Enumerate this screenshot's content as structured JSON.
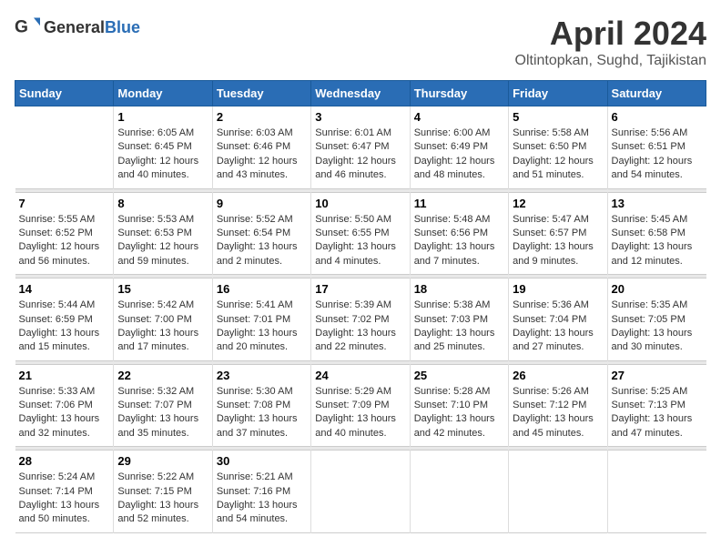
{
  "header": {
    "logo_general": "General",
    "logo_blue": "Blue",
    "title": "April 2024",
    "location": "Oltintopkan, Sughd, Tajikistan"
  },
  "weekdays": [
    "Sunday",
    "Monday",
    "Tuesday",
    "Wednesday",
    "Thursday",
    "Friday",
    "Saturday"
  ],
  "weeks": [
    [
      {
        "day": "",
        "sunrise": "",
        "sunset": "",
        "daylight": ""
      },
      {
        "day": "1",
        "sunrise": "Sunrise: 6:05 AM",
        "sunset": "Sunset: 6:45 PM",
        "daylight": "Daylight: 12 hours and 40 minutes."
      },
      {
        "day": "2",
        "sunrise": "Sunrise: 6:03 AM",
        "sunset": "Sunset: 6:46 PM",
        "daylight": "Daylight: 12 hours and 43 minutes."
      },
      {
        "day": "3",
        "sunrise": "Sunrise: 6:01 AM",
        "sunset": "Sunset: 6:47 PM",
        "daylight": "Daylight: 12 hours and 46 minutes."
      },
      {
        "day": "4",
        "sunrise": "Sunrise: 6:00 AM",
        "sunset": "Sunset: 6:49 PM",
        "daylight": "Daylight: 12 hours and 48 minutes."
      },
      {
        "day": "5",
        "sunrise": "Sunrise: 5:58 AM",
        "sunset": "Sunset: 6:50 PM",
        "daylight": "Daylight: 12 hours and 51 minutes."
      },
      {
        "day": "6",
        "sunrise": "Sunrise: 5:56 AM",
        "sunset": "Sunset: 6:51 PM",
        "daylight": "Daylight: 12 hours and 54 minutes."
      }
    ],
    [
      {
        "day": "7",
        "sunrise": "Sunrise: 5:55 AM",
        "sunset": "Sunset: 6:52 PM",
        "daylight": "Daylight: 12 hours and 56 minutes."
      },
      {
        "day": "8",
        "sunrise": "Sunrise: 5:53 AM",
        "sunset": "Sunset: 6:53 PM",
        "daylight": "Daylight: 12 hours and 59 minutes."
      },
      {
        "day": "9",
        "sunrise": "Sunrise: 5:52 AM",
        "sunset": "Sunset: 6:54 PM",
        "daylight": "Daylight: 13 hours and 2 minutes."
      },
      {
        "day": "10",
        "sunrise": "Sunrise: 5:50 AM",
        "sunset": "Sunset: 6:55 PM",
        "daylight": "Daylight: 13 hours and 4 minutes."
      },
      {
        "day": "11",
        "sunrise": "Sunrise: 5:48 AM",
        "sunset": "Sunset: 6:56 PM",
        "daylight": "Daylight: 13 hours and 7 minutes."
      },
      {
        "day": "12",
        "sunrise": "Sunrise: 5:47 AM",
        "sunset": "Sunset: 6:57 PM",
        "daylight": "Daylight: 13 hours and 9 minutes."
      },
      {
        "day": "13",
        "sunrise": "Sunrise: 5:45 AM",
        "sunset": "Sunset: 6:58 PM",
        "daylight": "Daylight: 13 hours and 12 minutes."
      }
    ],
    [
      {
        "day": "14",
        "sunrise": "Sunrise: 5:44 AM",
        "sunset": "Sunset: 6:59 PM",
        "daylight": "Daylight: 13 hours and 15 minutes."
      },
      {
        "day": "15",
        "sunrise": "Sunrise: 5:42 AM",
        "sunset": "Sunset: 7:00 PM",
        "daylight": "Daylight: 13 hours and 17 minutes."
      },
      {
        "day": "16",
        "sunrise": "Sunrise: 5:41 AM",
        "sunset": "Sunset: 7:01 PM",
        "daylight": "Daylight: 13 hours and 20 minutes."
      },
      {
        "day": "17",
        "sunrise": "Sunrise: 5:39 AM",
        "sunset": "Sunset: 7:02 PM",
        "daylight": "Daylight: 13 hours and 22 minutes."
      },
      {
        "day": "18",
        "sunrise": "Sunrise: 5:38 AM",
        "sunset": "Sunset: 7:03 PM",
        "daylight": "Daylight: 13 hours and 25 minutes."
      },
      {
        "day": "19",
        "sunrise": "Sunrise: 5:36 AM",
        "sunset": "Sunset: 7:04 PM",
        "daylight": "Daylight: 13 hours and 27 minutes."
      },
      {
        "day": "20",
        "sunrise": "Sunrise: 5:35 AM",
        "sunset": "Sunset: 7:05 PM",
        "daylight": "Daylight: 13 hours and 30 minutes."
      }
    ],
    [
      {
        "day": "21",
        "sunrise": "Sunrise: 5:33 AM",
        "sunset": "Sunset: 7:06 PM",
        "daylight": "Daylight: 13 hours and 32 minutes."
      },
      {
        "day": "22",
        "sunrise": "Sunrise: 5:32 AM",
        "sunset": "Sunset: 7:07 PM",
        "daylight": "Daylight: 13 hours and 35 minutes."
      },
      {
        "day": "23",
        "sunrise": "Sunrise: 5:30 AM",
        "sunset": "Sunset: 7:08 PM",
        "daylight": "Daylight: 13 hours and 37 minutes."
      },
      {
        "day": "24",
        "sunrise": "Sunrise: 5:29 AM",
        "sunset": "Sunset: 7:09 PM",
        "daylight": "Daylight: 13 hours and 40 minutes."
      },
      {
        "day": "25",
        "sunrise": "Sunrise: 5:28 AM",
        "sunset": "Sunset: 7:10 PM",
        "daylight": "Daylight: 13 hours and 42 minutes."
      },
      {
        "day": "26",
        "sunrise": "Sunrise: 5:26 AM",
        "sunset": "Sunset: 7:12 PM",
        "daylight": "Daylight: 13 hours and 45 minutes."
      },
      {
        "day": "27",
        "sunrise": "Sunrise: 5:25 AM",
        "sunset": "Sunset: 7:13 PM",
        "daylight": "Daylight: 13 hours and 47 minutes."
      }
    ],
    [
      {
        "day": "28",
        "sunrise": "Sunrise: 5:24 AM",
        "sunset": "Sunset: 7:14 PM",
        "daylight": "Daylight: 13 hours and 50 minutes."
      },
      {
        "day": "29",
        "sunrise": "Sunrise: 5:22 AM",
        "sunset": "Sunset: 7:15 PM",
        "daylight": "Daylight: 13 hours and 52 minutes."
      },
      {
        "day": "30",
        "sunrise": "Sunrise: 5:21 AM",
        "sunset": "Sunset: 7:16 PM",
        "daylight": "Daylight: 13 hours and 54 minutes."
      },
      {
        "day": "",
        "sunrise": "",
        "sunset": "",
        "daylight": ""
      },
      {
        "day": "",
        "sunrise": "",
        "sunset": "",
        "daylight": ""
      },
      {
        "day": "",
        "sunrise": "",
        "sunset": "",
        "daylight": ""
      },
      {
        "day": "",
        "sunrise": "",
        "sunset": "",
        "daylight": ""
      }
    ]
  ]
}
